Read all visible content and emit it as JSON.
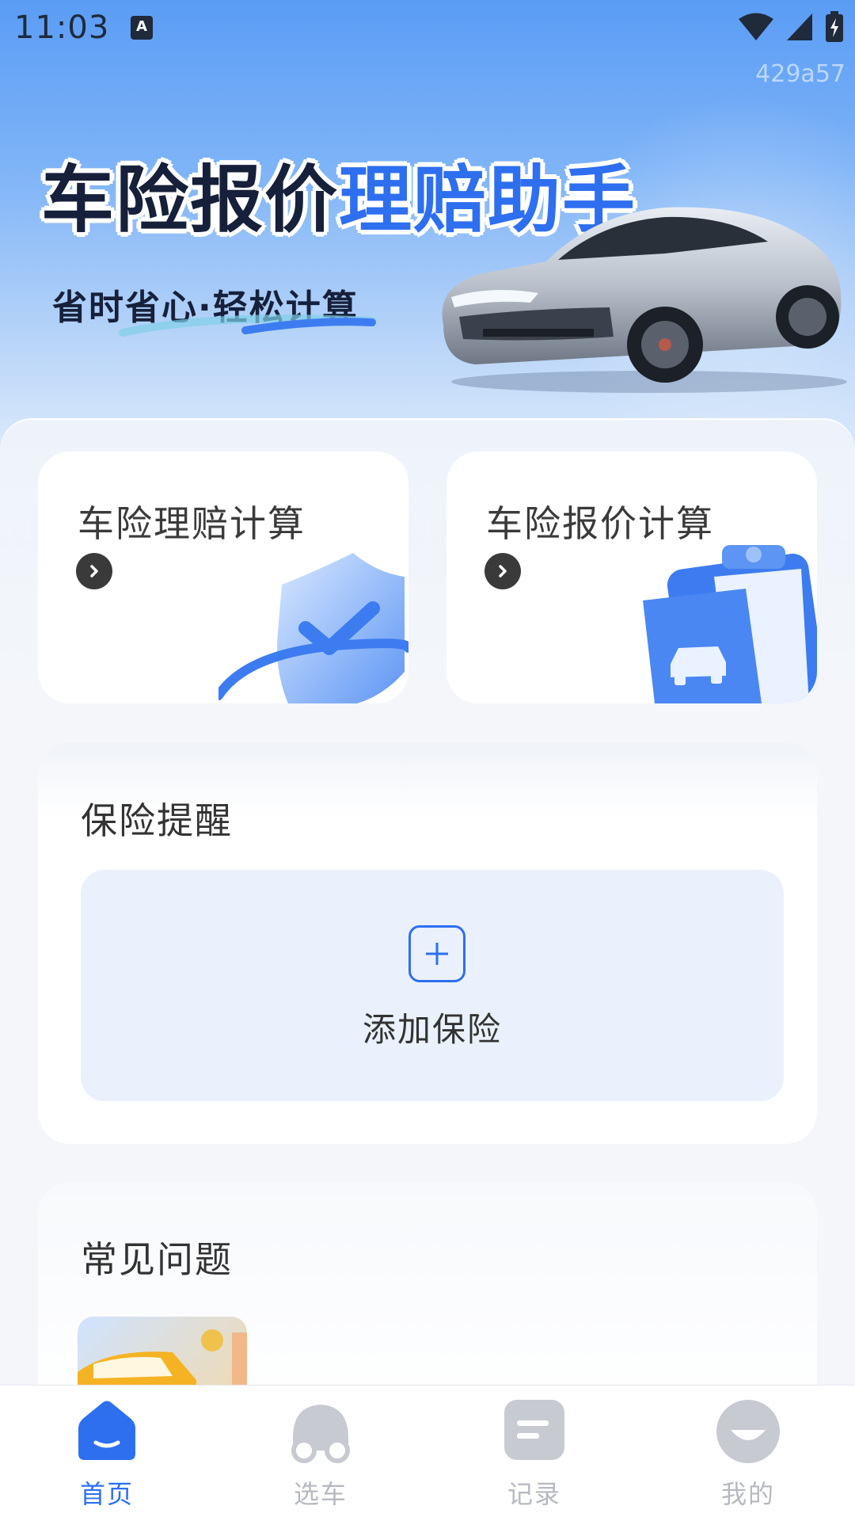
{
  "status_bar": {
    "time": "11:03",
    "badge": "A"
  },
  "watermark": "429a57",
  "hero": {
    "title_part1": "车险报价",
    "title_part2": "理赔助手",
    "subtitle": "省时省心·轻松计算"
  },
  "quick_actions": [
    {
      "label": "车险理赔计算",
      "icon": "shield-check-icon"
    },
    {
      "label": "车险报价计算",
      "icon": "clipboard-car-icon"
    }
  ],
  "insurance_reminder": {
    "title": "保险提醒",
    "add_label": "添加保险"
  },
  "faq": {
    "title": "常见问题"
  },
  "tabbar": {
    "items": [
      {
        "label": "首页",
        "icon": "home-icon",
        "active": true
      },
      {
        "label": "选车",
        "icon": "car-icon",
        "active": false
      },
      {
        "label": "记录",
        "icon": "record-icon",
        "active": false
      },
      {
        "label": "我的",
        "icon": "profile-icon",
        "active": false
      }
    ]
  },
  "colors": {
    "accent": "#2e6ff0",
    "dark_text": "#16203a",
    "inactive": "#b6b9c0"
  }
}
